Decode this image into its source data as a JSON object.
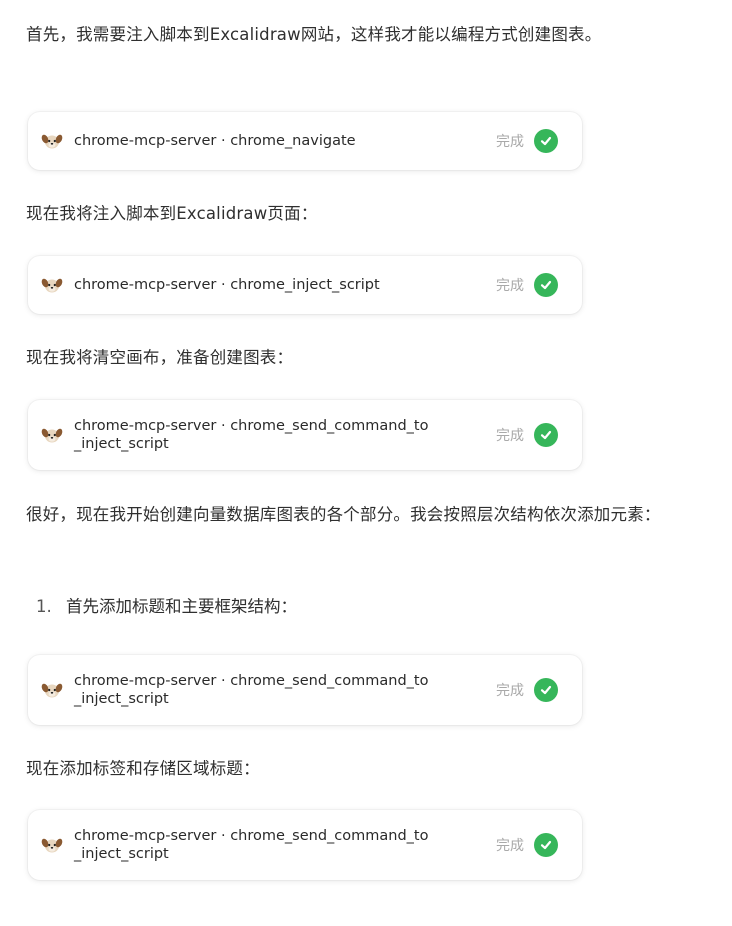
{
  "colors": {
    "success": "#36b65a",
    "status_text": "#a9a9a9",
    "body_text": "#2f2f2f"
  },
  "messages": [
    {
      "text": "首先，我需要注入脚本到Excalidraw网站，这样我才能以编程方式创建图表。"
    },
    {
      "text": "现在我将注入脚本到Excalidraw页面："
    },
    {
      "text": "现在我将清空画布，准备创建图表："
    },
    {
      "text": "很好，现在我开始创建向量数据库图表的各个部分。我会按照层次结构依次添加元素："
    },
    {
      "text": "现在添加标签和存储区域标题："
    }
  ],
  "list": {
    "number": "1.",
    "text": "首先添加标题和主要框架结构："
  },
  "tool_calls": [
    {
      "name": "chrome-mcp-server · chrome_navigate",
      "status": "完成",
      "icon": "dog-avatar-icon"
    },
    {
      "name": "chrome-mcp-server · chrome_inject_script",
      "status": "完成",
      "icon": "dog-avatar-icon"
    },
    {
      "name": "chrome-mcp-server · chrome_send_command_to\n_inject_script",
      "status": "完成",
      "icon": "dog-avatar-icon"
    },
    {
      "name": "chrome-mcp-server · chrome_send_command_to\n_inject_script",
      "status": "完成",
      "icon": "dog-avatar-icon"
    },
    {
      "name": "chrome-mcp-server · chrome_send_command_to\n_inject_script",
      "status": "完成",
      "icon": "dog-avatar-icon"
    }
  ]
}
